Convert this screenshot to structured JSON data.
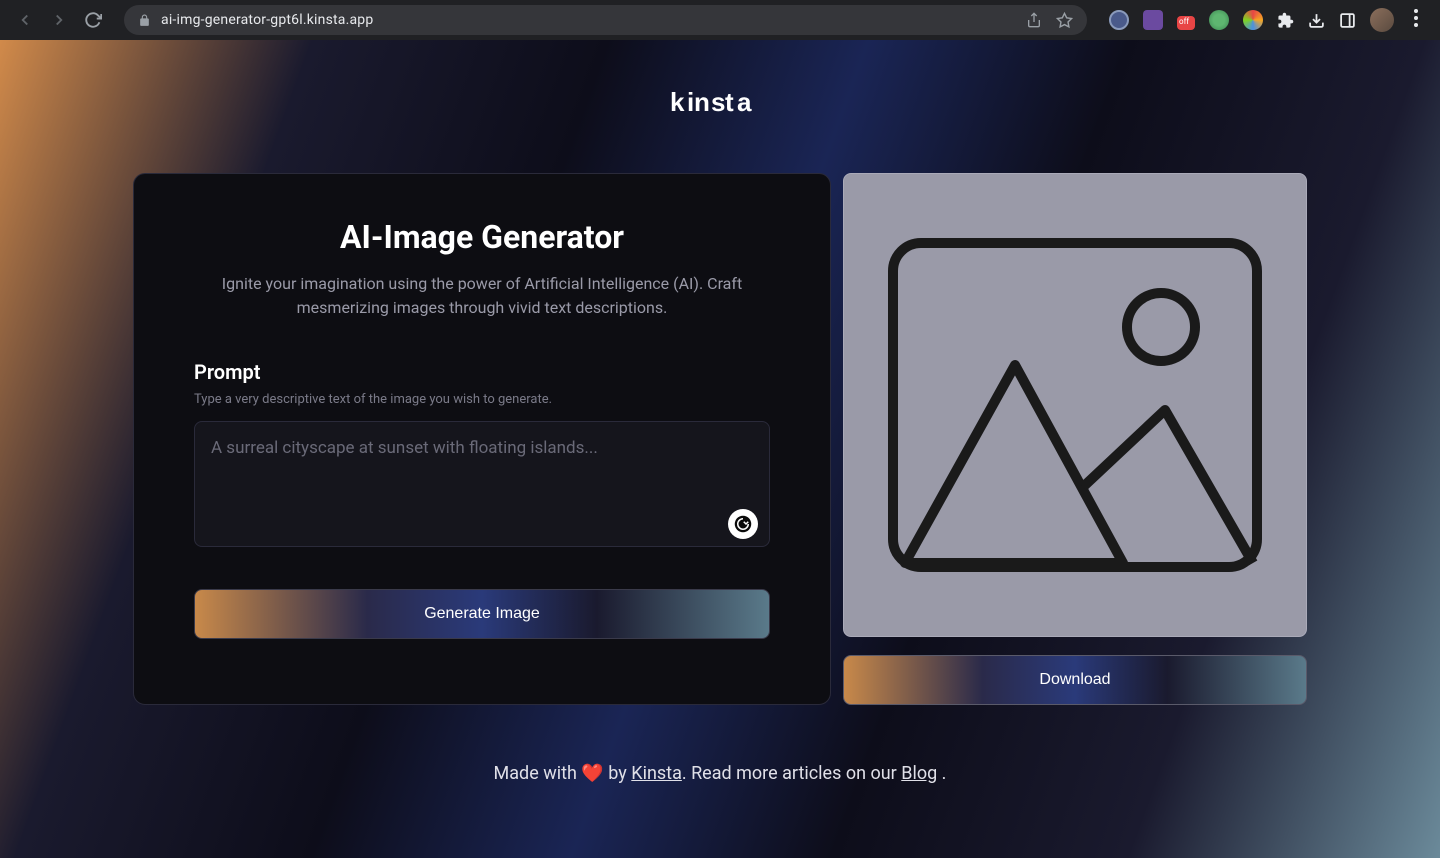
{
  "browser": {
    "url": "ai-img-generator-gpt6l.kinsta.app"
  },
  "logo": "KInsta",
  "card": {
    "title": "AI-Image Generator",
    "subtitle": "Ignite your imagination using the power of Artificial Intelligence (AI). Craft mesmerizing images through vivid text descriptions.",
    "prompt_label": "Prompt",
    "prompt_hint": "Type a very descriptive text of the image you wish to generate.",
    "prompt_placeholder": "A surreal cityscape at sunset with floating islands...",
    "generate_button": "Generate Image"
  },
  "preview": {
    "download_button": "Download"
  },
  "footer": {
    "prefix": "Made with ",
    "heart": "❤️",
    "by": " by ",
    "kinsta": "Kinsta",
    "mid": ". Read more articles on our ",
    "blog": "Blog",
    "suffix": " ."
  }
}
